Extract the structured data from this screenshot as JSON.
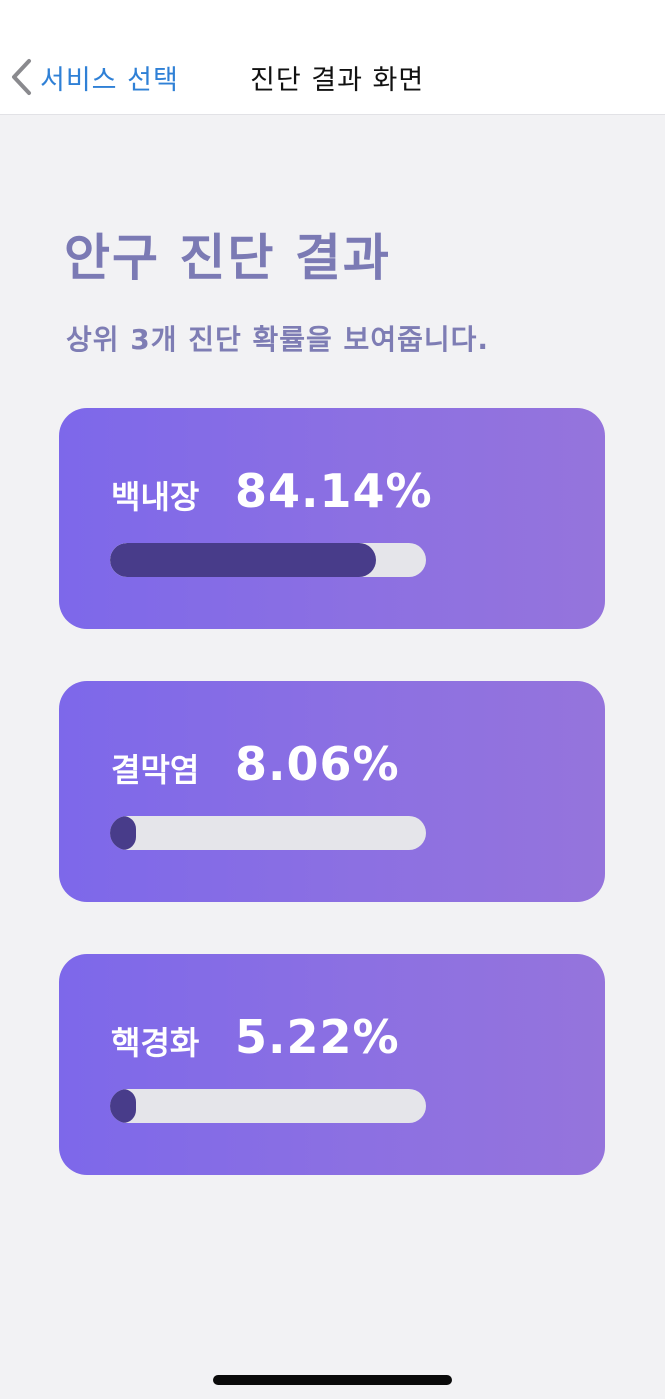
{
  "nav": {
    "back_label": "서비스 선택",
    "title": "진단 결과 화면"
  },
  "page": {
    "title": "안구 진단 결과",
    "subtitle": "상위 3개 진단 확률을 보여줍니다."
  },
  "results": [
    {
      "label": "백내장",
      "value": "84.14%",
      "fraction": 0.8414
    },
    {
      "label": "결막염",
      "value": "8.06%",
      "fraction": 0.0806
    },
    {
      "label": "핵경화",
      "value": "5.22%",
      "fraction": 0.0522
    }
  ],
  "colors": {
    "card_gradient_start": "#7d68ea",
    "card_gradient_end": "#9574dc",
    "bar_fill": "#483c8a",
    "bar_track": "#e5e5ea",
    "back_link": "#2f80d6"
  },
  "icons": {
    "back": "chevron-left-icon"
  }
}
